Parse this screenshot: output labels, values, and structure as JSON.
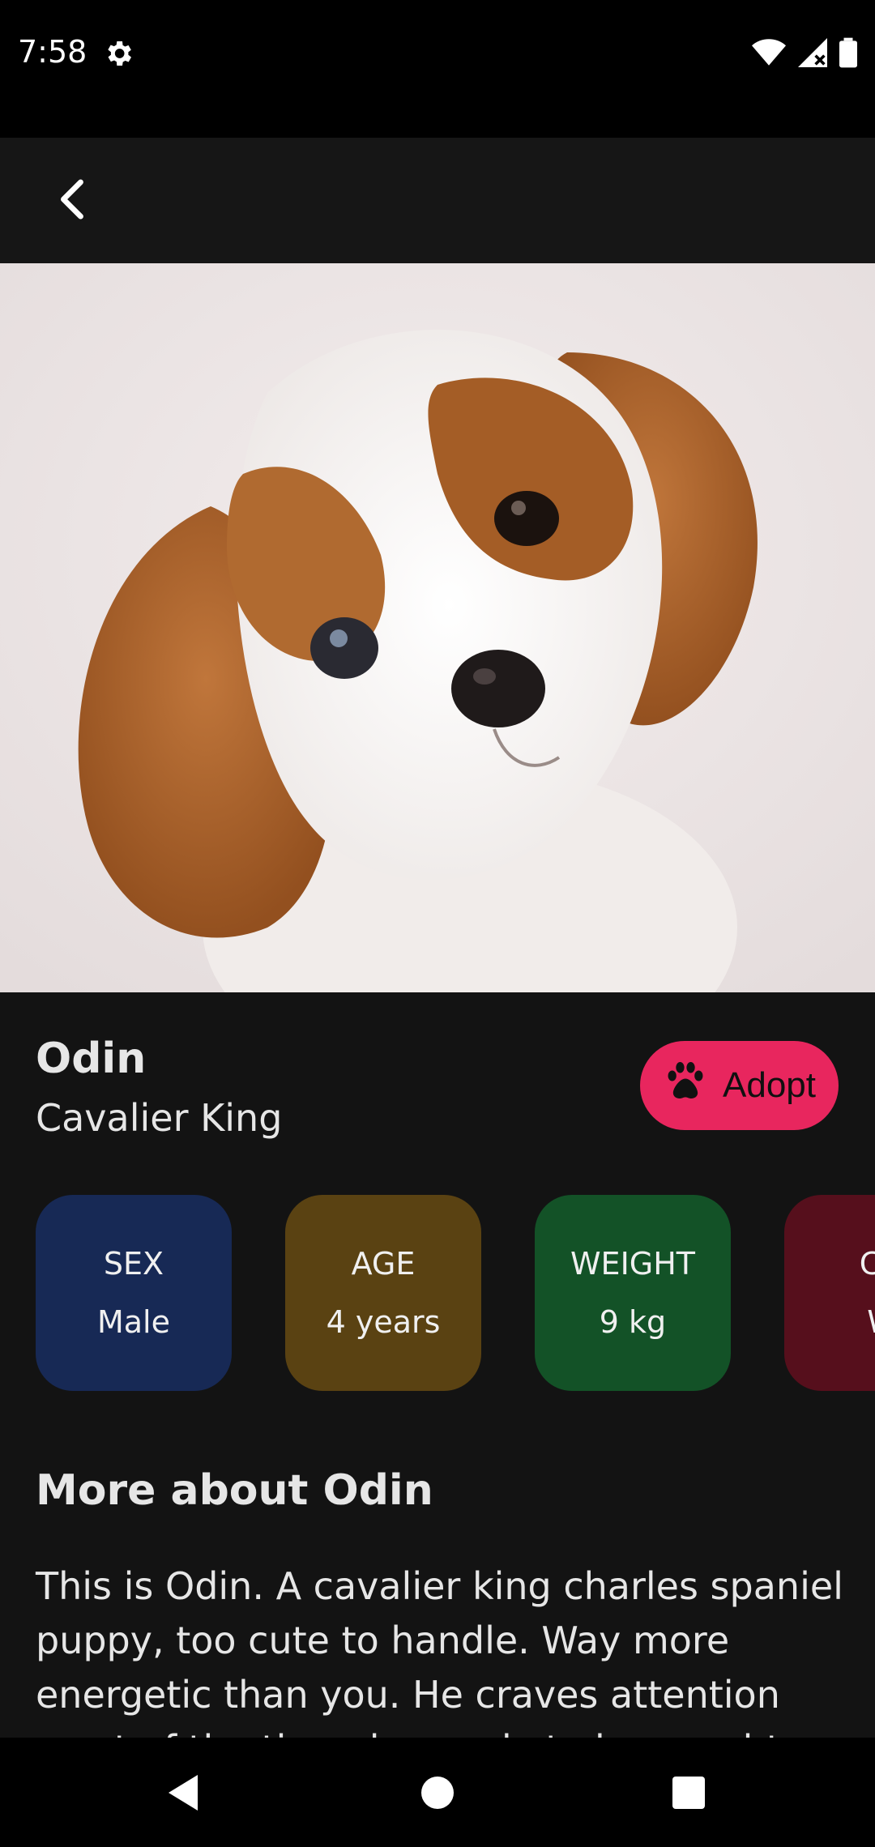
{
  "status_bar": {
    "time": "7:58",
    "icons": [
      "gear-icon",
      "wifi-icon",
      "signal-icon",
      "battery-icon"
    ]
  },
  "app_bar": {
    "back_icon": "chevron-left-icon"
  },
  "pet": {
    "name": "Odin",
    "breed": "Cavalier King",
    "adopt_label": "Adopt",
    "adopt_icon": "paw-icon"
  },
  "info_cards": [
    {
      "label": "SEX",
      "value": "Male",
      "color": "#172955"
    },
    {
      "label": "AGE",
      "value": "4 years",
      "color": "#5a4212"
    },
    {
      "label": "WEIGHT",
      "value": "9 kg",
      "color": "#135227"
    },
    {
      "label": "CO",
      "value": "W",
      "color": "#560f1c"
    }
  ],
  "about": {
    "title": "More about Odin",
    "text": "This is Odin. A cavalier king charles spaniel puppy, too cute to handle. Way more energetic than you. He craves attention most of the time, be ready to be sought after"
  },
  "colors": {
    "background": "#131313",
    "accent": "#e8265e"
  }
}
